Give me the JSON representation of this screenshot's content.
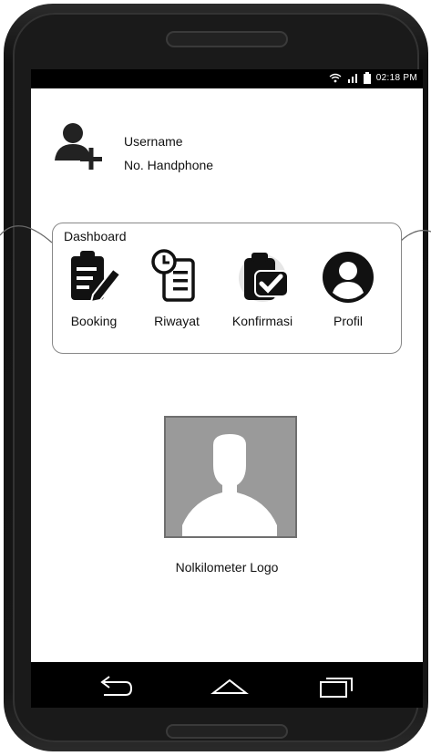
{
  "status_bar": {
    "time": "02:18 PM"
  },
  "user": {
    "username_label": "Username",
    "phone_label": "No. Handphone"
  },
  "dashboard": {
    "title": "Dashboard",
    "items": [
      {
        "label": "Booking",
        "icon": "clipboard-edit-icon"
      },
      {
        "label": "Riwayat",
        "icon": "history-document-icon"
      },
      {
        "label": "Konfirmasi",
        "icon": "confirm-check-icon"
      },
      {
        "label": "Profil",
        "icon": "user-circle-icon"
      }
    ]
  },
  "logo": {
    "caption": "Nolkilometer Logo"
  }
}
